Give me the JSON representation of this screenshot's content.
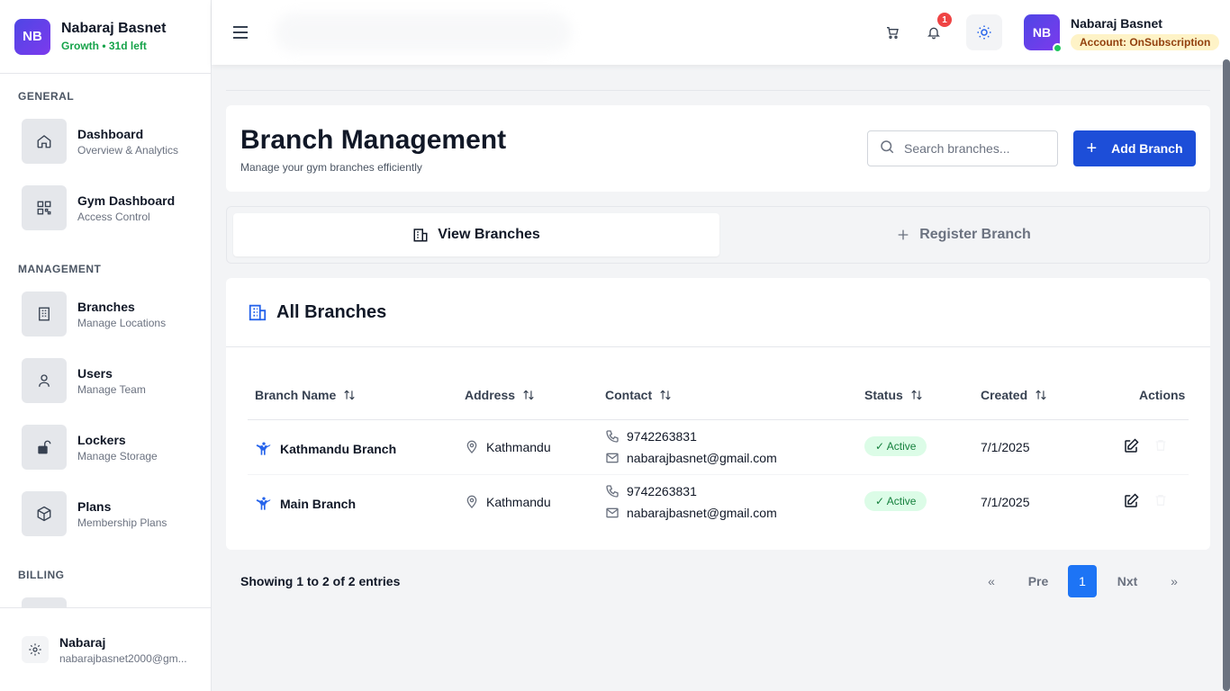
{
  "brand": {
    "initials": "NB",
    "name": "Nabaraj Basnet",
    "plan": "Growth • 31d left"
  },
  "sidebar": {
    "sections": {
      "general": "GENERAL",
      "management": "MANAGEMENT",
      "billing": "BILLING"
    },
    "items": [
      {
        "label": "Dashboard",
        "sub": "Overview & Analytics",
        "icon": "home-icon"
      },
      {
        "label": "Gym Dashboard",
        "sub": "Access Control",
        "icon": "qr-icon"
      },
      {
        "label": "Branches",
        "sub": "Manage Locations",
        "icon": "building-icon"
      },
      {
        "label": "Users",
        "sub": "Manage Team",
        "icon": "user-icon"
      },
      {
        "label": "Lockers",
        "sub": "Manage Storage",
        "icon": "lock-icon"
      },
      {
        "label": "Plans",
        "sub": "Membership Plans",
        "icon": "box-icon"
      }
    ],
    "footer": {
      "name": "Nabaraj",
      "email": "nabarajbasnet2000@gm..."
    }
  },
  "header": {
    "notification_count": "1",
    "user": {
      "initials": "NB",
      "name": "Nabaraj Basnet",
      "account": "Account: OnSubscription"
    }
  },
  "page": {
    "title": "Branch Management",
    "subtitle": "Manage your gym branches efficiently",
    "search_placeholder": "Search branches...",
    "add_button": "Add Branch",
    "tabs": {
      "view": "View Branches",
      "register": "Register Branch"
    }
  },
  "table": {
    "title": "All Branches",
    "columns": [
      "Branch Name",
      "Address",
      "Contact",
      "Status",
      "Created",
      "Actions"
    ],
    "rows": [
      {
        "name": "Kathmandu Branch",
        "address": "Kathmandu",
        "phone": "9742263831",
        "email": "nabarajbasnet@gmail.com",
        "status": "Active",
        "created": "7/1/2025"
      },
      {
        "name": "Main Branch",
        "address": "Kathmandu",
        "phone": "9742263831",
        "email": "nabarajbasnet@gmail.com",
        "status": "Active",
        "created": "7/1/2025"
      }
    ]
  },
  "pagination": {
    "info": "Showing 1 to 2 of 2 entries",
    "first": "«",
    "prev": "Pre",
    "current": "1",
    "next": "Nxt",
    "last": "»"
  },
  "colors": {
    "primary": "#1d4ed8",
    "active_bg": "#dcfce7",
    "active_text": "#15803d",
    "badge": "#ef4444",
    "account_bg": "#fef3c7"
  }
}
